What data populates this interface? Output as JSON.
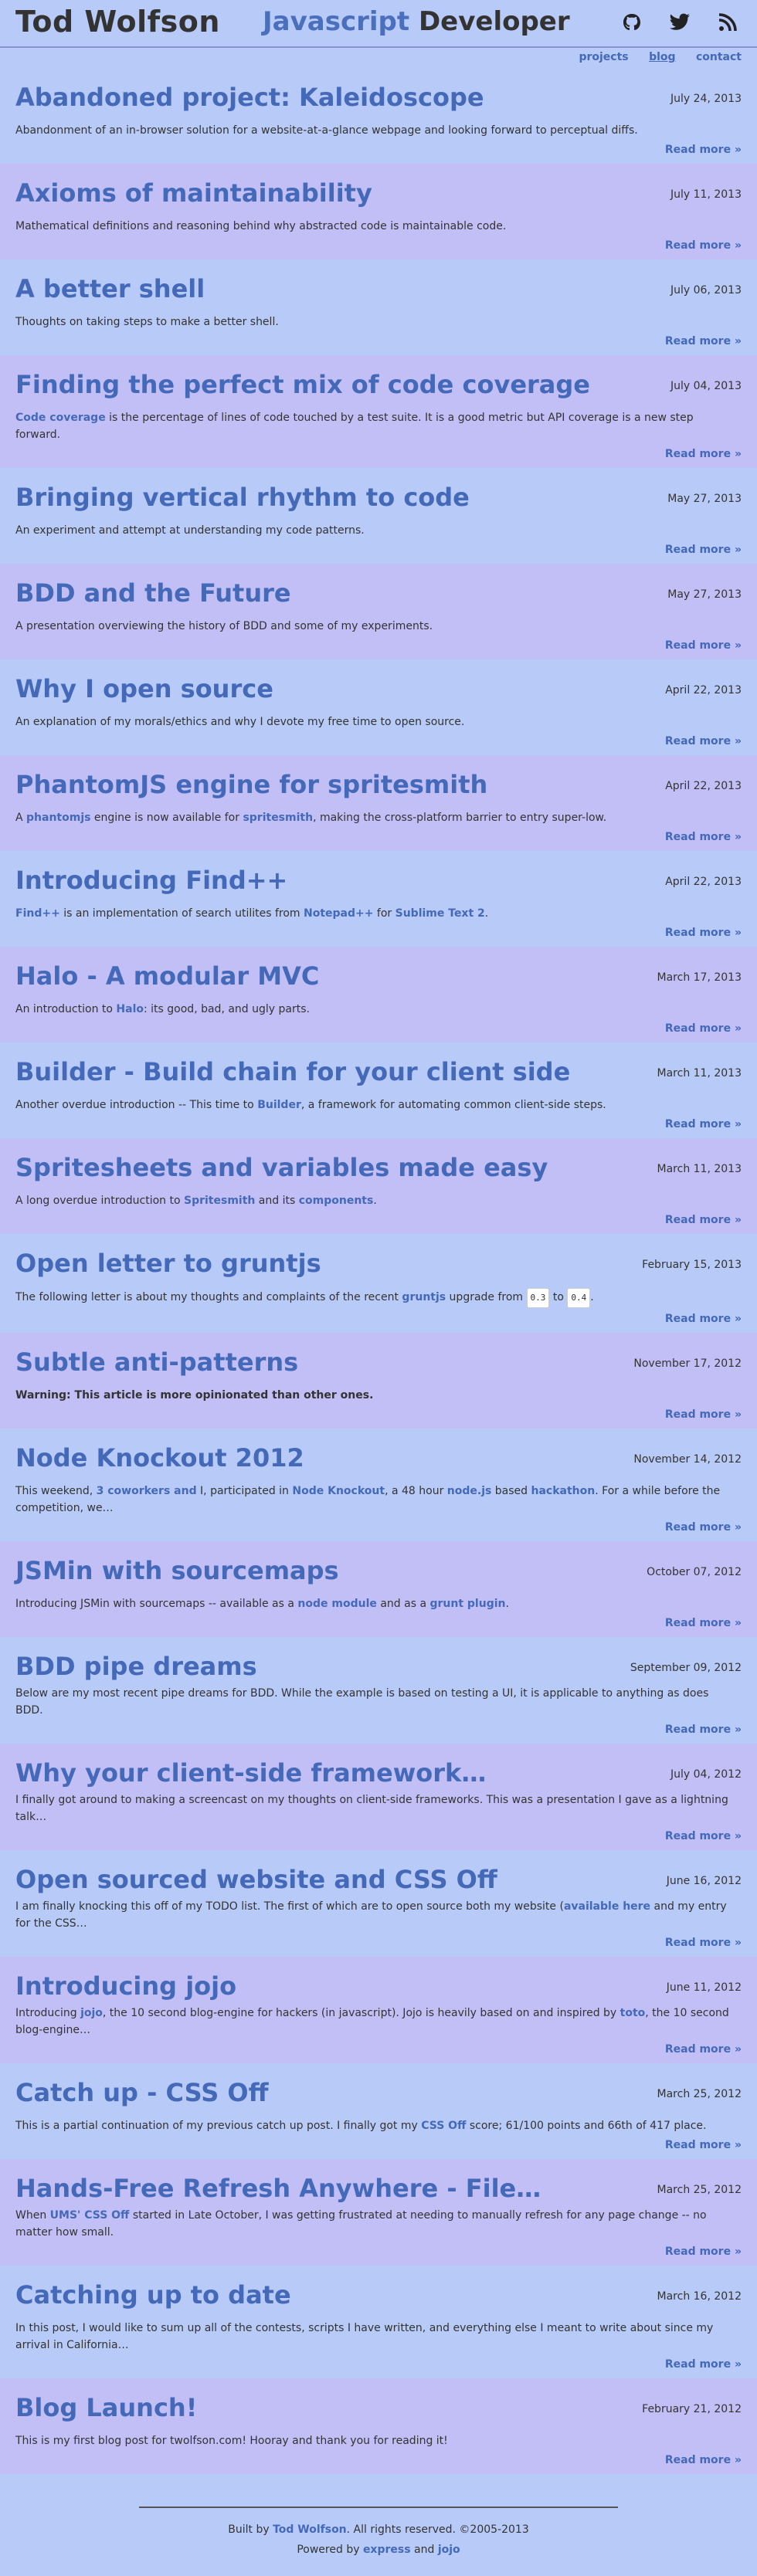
{
  "header": {
    "site_name": "Tod Wolfson",
    "tagline_highlight": "Javascript",
    "tagline_rest": "Developer",
    "icons": [
      "github-icon",
      "twitter-icon",
      "rss-icon"
    ]
  },
  "nav": {
    "projects": "projects",
    "blog": "blog",
    "contact": "contact"
  },
  "read_more": "Read more »",
  "posts": [
    {
      "title": "Abandoned project: Kaleidoscope",
      "date": "July 24, 2013",
      "summary": "Abandonment of an in-browser solution for a website-at-a-glance webpage and looking forward to perceptual diffs."
    },
    {
      "title": "Axioms of maintainability",
      "date": "July 11, 2013",
      "summary": "Mathematical definitions and reasoning behind why abstracted code is maintainable code."
    },
    {
      "title": "A better shell",
      "date": "July 06, 2013",
      "summary": "Thoughts on taking steps to make a better shell."
    },
    {
      "title": "Finding the perfect mix of code coverage",
      "date": "July 04, 2013",
      "summary_link": "Code coverage",
      "summary": " is the percentage of lines of code touched by a test suite. It is a good metric but API coverage is a new step forward."
    },
    {
      "title": "Bringing vertical rhythm to code",
      "date": "May 27, 2013",
      "summary": "An experiment and attempt at understanding my code patterns."
    },
    {
      "title": "BDD and the Future",
      "date": "May 27, 2013",
      "summary": "A presentation overviewing the history of BDD and some of my experiments."
    },
    {
      "title": "Why I open source",
      "date": "April 22, 2013",
      "summary": "An explanation of my morals/ethics and why I devote my free time to open source."
    },
    {
      "title": "PhantomJS engine for spritesmith",
      "date": "April 22, 2013",
      "s1": "A ",
      "l1": "phantomjs",
      "s2": " engine is now available for ",
      "l2": "spritesmith",
      "s3": ", making the cross-platform barrier to entry super-low."
    },
    {
      "title": "Introducing Find++",
      "date": "April 22, 2013",
      "l1": "Find++",
      "s1": " is an implementation of search utilites from ",
      "l2": "Notepad++",
      "s2": " for ",
      "l3": "Sublime Text 2",
      "s3": "."
    },
    {
      "title": "Halo - A modular MVC",
      "date": "March 17, 2013",
      "s1": "An introduction to ",
      "l1": "Halo",
      "s2": ": its good, bad, and ugly parts."
    },
    {
      "title": "Builder - Build chain for your client side",
      "date": "March 11, 2013",
      "s1": "Another overdue introduction -- This time to ",
      "l1": "Builder",
      "s2": ", a framework for automating common client-side steps."
    },
    {
      "title": "Spritesheets and variables made easy",
      "date": "March 11, 2013",
      "s1": "A long overdue introduction to ",
      "l1": "Spritesmith",
      "s2": " and its ",
      "l2": "components",
      "s3": "."
    },
    {
      "title": "Open letter to gruntjs",
      "date": "February 15, 2013",
      "s1": "The following letter is about my thoughts and complaints of the recent ",
      "l1": "gruntjs",
      "s2": " upgrade from ",
      "c1": "0.3",
      "s3": " to ",
      "c2": "0.4",
      "s4": "."
    },
    {
      "title": "Subtle anti-patterns",
      "date": "November 17, 2012",
      "summary_bold": "Warning: This article is more opinionated than other ones."
    },
    {
      "title": "Node Knockout 2012",
      "date": "November 14, 2012",
      "s1": "This weekend, ",
      "l1": "3 coworkers and",
      "s2": " I, participated in ",
      "l2": "Node Knockout",
      "s3": ", a 48 hour ",
      "l3": "node.js",
      "s4": " based ",
      "l4": "hackathon",
      "s5": ". For a while before the competition, we…"
    },
    {
      "title": "JSMin with sourcemaps",
      "date": "October 07, 2012",
      "s1": "Introducing JSMin with sourcemaps -- available as a ",
      "l1": "node module",
      "s2": " and as a ",
      "l2": "grunt plugin",
      "s3": "."
    },
    {
      "title": "BDD pipe dreams",
      "date": "September 09, 2012",
      "summary": "Below are my most recent pipe dreams for BDD. While the example is based on testing a UI, it is applicable to anything as does BDD."
    },
    {
      "title": "Why your client-side framework…",
      "date": "July 04, 2012",
      "summary": "I finally got around to making a screencast on my thoughts on client-side frameworks. This was a presentation I gave as a lightning talk…"
    },
    {
      "title": "Open sourced website and CSS Off",
      "date": "June 16, 2012",
      "s1": "I am finally knocking this off of my TODO list. The first of which are to open source both my website (",
      "l1": "available here",
      "s2": " and my entry for the CSS…"
    },
    {
      "title": "Introducing jojo",
      "date": "June 11, 2012",
      "s1": "Introducing ",
      "l1": "jojo",
      "s2": ", the 10 second blog-engine for hackers (in javascript). Jojo is heavily based on and inspired by ",
      "l2": "toto",
      "s3": ", the 10 second blog-engine…"
    },
    {
      "title": "Catch up - CSS Off",
      "date": "March 25, 2012",
      "s1": "This is a partial continuation of my previous catch up post. I finally got my ",
      "l1": "CSS Off",
      "s2": " score; 61/100 points and 66th of 417 place."
    },
    {
      "title": "Hands-Free Refresh Anywhere - File…",
      "date": "March 25, 2012",
      "s1": "When ",
      "l1": "UMS' CSS Off",
      "s2": " started in Late October, I was getting frustrated at needing to manually refresh for any page change -- no matter how small."
    },
    {
      "title": "Catching up to date",
      "date": "March 16, 2012",
      "summary": "In this post, I would like to sum up all of the contests, scripts I have written, and everything else I meant to write about since my arrival in California…"
    },
    {
      "title": "Blog Launch!",
      "date": "February 21, 2012",
      "summary": "This is my first blog post for twolfson.com! Hooray and thank you for reading it!"
    }
  ],
  "footer": {
    "built_by": "Built by ",
    "author": "Tod Wolfson",
    "rights": ". All rights reserved. ©2005-2013",
    "powered_by": "Powered by ",
    "express": "express",
    "and": " and ",
    "jojo": "jojo"
  },
  "colors": {
    "background": "#b8caf7",
    "alt_background": "#c2bff7",
    "link": "#4469b8"
  }
}
